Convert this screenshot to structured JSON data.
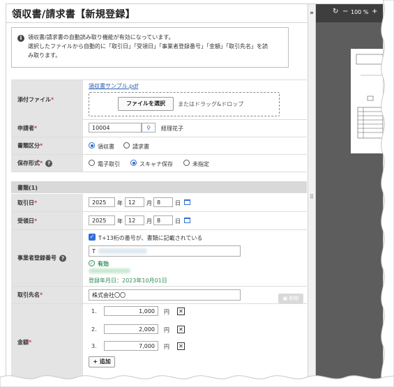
{
  "title": "領収書/請求書【新規登録】",
  "info": {
    "line1": "領収書/請求書の自動読み取り機能が有効になっています。",
    "line2": "選択したファイルから自動的に「取引日」「受領日」「事業者登録番号」「金額」「取引先名」を読",
    "line3": "み取ります。"
  },
  "attachment": {
    "label": "添付ファイル",
    "file_link": "領収書サンプル.pdf",
    "select_button": "ファイルを選択",
    "drop_hint": "またはドラッグ&ドロップ"
  },
  "applicant": {
    "label": "申請者",
    "id": "10004",
    "name": "経理花子"
  },
  "doc_type": {
    "label": "書類区分",
    "options": [
      "領収書",
      "請求書"
    ],
    "selected": "領収書"
  },
  "storage": {
    "label": "保存形式",
    "options": [
      "電子取引",
      "スキャナ保存",
      "未指定"
    ],
    "selected": "スキャナ保存"
  },
  "section_title": "書類(1)",
  "transaction_date": {
    "label": "取引日",
    "year": "2025",
    "year_unit": "年",
    "month": "12",
    "month_unit": "月",
    "day": "8",
    "day_unit": "日"
  },
  "received_date": {
    "label": "受領日",
    "year": "2025",
    "year_unit": "年",
    "month": "12",
    "month_unit": "月",
    "day": "8",
    "day_unit": "日"
  },
  "registration": {
    "label": "事業者登録番号",
    "checkbox_label": "T+13桁の番号が、書類に記載されている",
    "number_prefix": "T",
    "status": "有効",
    "registered": "登録年月日：2023年10月01日"
  },
  "partner": {
    "label": "取引先名",
    "value": "株式会社〇〇"
  },
  "delete_button": "削除",
  "amount": {
    "label": "金額",
    "rows": [
      {
        "num": "1.",
        "value": "1,000",
        "unit": "円"
      },
      {
        "num": "2.",
        "value": "2,000",
        "unit": "円"
      },
      {
        "num": "3.",
        "value": "7,000",
        "unit": "円"
      }
    ],
    "add_button": "追加"
  },
  "viewer": {
    "zoom": "100 %",
    "collapse": "»"
  },
  "colors": {
    "accent": "#2f6fd6",
    "required": "#d9363e",
    "valid": "#2e8b57"
  }
}
